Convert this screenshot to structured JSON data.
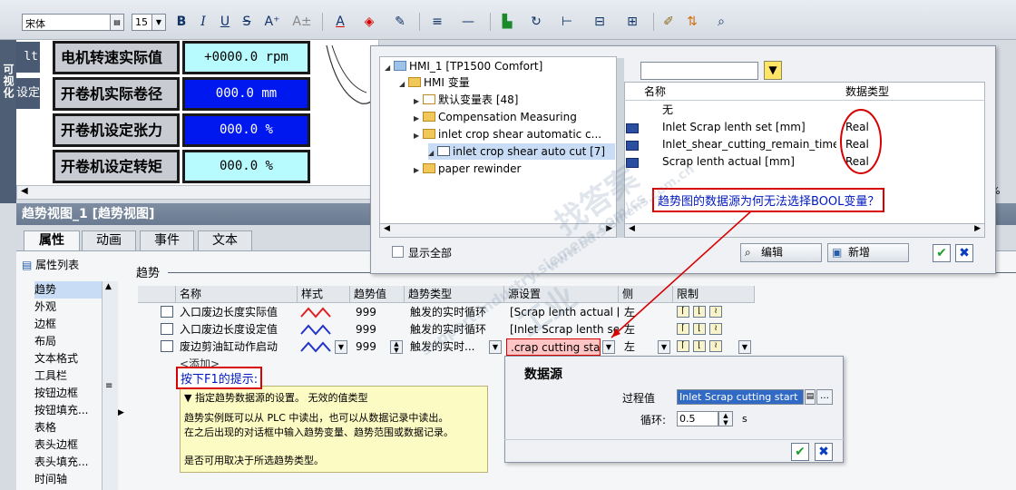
{
  "toolbar": {
    "font_name": "宋体",
    "font_size": "15",
    "bold": "B",
    "italic": "I",
    "underline": "U",
    "strike": "S",
    "superscript": "A⁺"
  },
  "side_panel": {
    "vertical_label": "可视化",
    "tab1": "lt",
    "tab2": "设定"
  },
  "hmi_screen": {
    "rows": [
      {
        "label": "电机转速实际值",
        "value": "+0000.0 rpm",
        "style": "cyan"
      },
      {
        "label": "开卷机实际卷径",
        "value": "000.0 mm",
        "style": "blue"
      },
      {
        "label": "开卷机设定张力",
        "value": "000.0 %",
        "style": "blue"
      },
      {
        "label": "开卷机设定转矩",
        "value": "000.0 %",
        "style": "cyan"
      }
    ]
  },
  "panel": {
    "title": "趋势视图_1 [趋势视图]",
    "tabs": [
      "属性",
      "动画",
      "事件",
      "文本"
    ],
    "prop_list_header": "属性列表",
    "section_title": "趋势",
    "nav_items": [
      "趋势",
      "外观",
      "边框",
      "布局",
      "文本格式",
      "工具栏",
      "按钮边框",
      "按钮填充...",
      "表格",
      "表头边框",
      "表头填充...",
      "时间轴"
    ]
  },
  "trend_grid": {
    "headers": [
      "名称",
      "样式",
      "趋势值",
      "趋势类型",
      "源设置",
      "侧",
      "限制"
    ],
    "rows": [
      {
        "name": "入口废边长度实际值",
        "value": "999",
        "type": "触发的实时循环",
        "source": "[Scrap lenth actual [...",
        "side": "左",
        "color": "#e02020"
      },
      {
        "name": "入口废边长度设定值",
        "value": "999",
        "type": "触发的实时循环",
        "source": "[Inlet Scrap lenth se...",
        "side": "左",
        "color": "#2233cc"
      },
      {
        "name": "废边剪油缸动作启动",
        "value": "999",
        "type": "触发的实时...",
        "source": ".crap cutting start]",
        "side": "左",
        "color": "#2233cc"
      }
    ],
    "add_row": "<添加>"
  },
  "tooltip": {
    "red_label": "按下F1的提示:",
    "title": "指定趋势数据源的设置。 无效的值类型",
    "line1": "趋势实例既可以从 PLC 中读出，也可以从数据记录中读出。",
    "line2": "在之后出现的对话框中输入趋势变量、趋势范围或数据记录。",
    "line3": "是否可用取决于所选趋势类型。"
  },
  "tag_dialog": {
    "tree": [
      {
        "label": "HMI_1 [TP1500 Comfort]",
        "level": 0,
        "expanded": true
      },
      {
        "label": "HMI 变量",
        "level": 1,
        "expanded": true
      },
      {
        "label": "默认变量表 [48]",
        "level": 2,
        "expanded": false
      },
      {
        "label": "Compensation Measuring",
        "level": 2,
        "expanded": false
      },
      {
        "label": "inlet crop shear automatic c...",
        "level": 2,
        "expanded": true
      },
      {
        "label": "inlet crop shear auto cut [7]",
        "level": 3,
        "expanded": true,
        "selected": true
      },
      {
        "label": "paper rewinder",
        "level": 2,
        "expanded": false
      }
    ],
    "list_headers": [
      "名称",
      "数据类型"
    ],
    "list": [
      {
        "name": "无",
        "type": ""
      },
      {
        "name": "Inlet Scrap lenth set [mm]",
        "type": "Real"
      },
      {
        "name": "Inlet_shear_cutting_remain_time_s",
        "type": "Real"
      },
      {
        "name": "Scrap lenth actual [mm]",
        "type": "Real"
      }
    ],
    "question": "趋势图的数据源为何无法选择BOOL变量？",
    "show_all": "显示全部",
    "edit_button": "编辑",
    "new_button": "新增"
  },
  "data_source": {
    "title": "数据源",
    "process_label": "过程值",
    "process_value": "Inlet Scrap cutting start",
    "cycle_label": "循环:",
    "cycle_value": "0.5",
    "cycle_unit": "s"
  },
  "zoom_fragment": "%",
  "watermarks": [
    "找答案",
    "工业",
    "www.ad.siemens.com.cn",
    "support.industry.siemens.com/cs"
  ],
  "colors": {
    "accent_red": "#d90000",
    "hmi_blue": "#0018f0",
    "hmi_cyan": "#b7fbff"
  }
}
